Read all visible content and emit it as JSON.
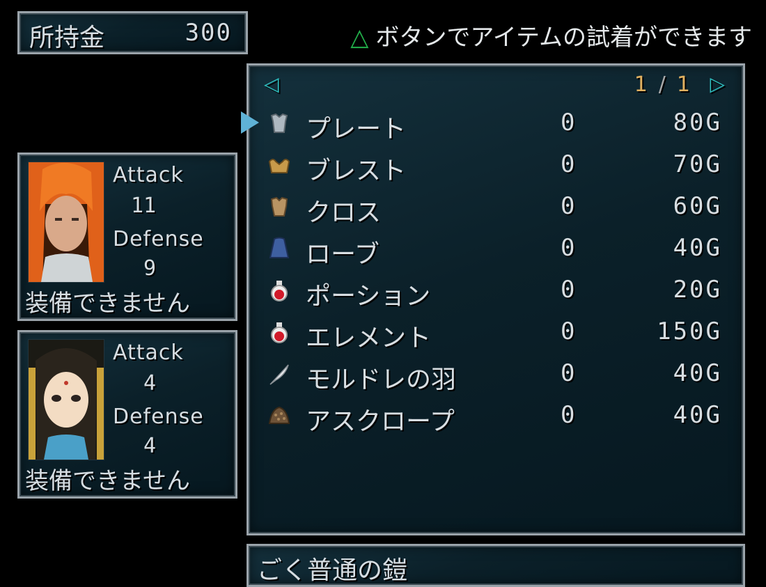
{
  "money": {
    "label": "所持金",
    "value": "300"
  },
  "hint": {
    "symbol": "△",
    "text": "ボタンでアイテムの試着ができます",
    "symbol_color": "#22b04a"
  },
  "pager": {
    "current": "1",
    "separator": "/",
    "total": "1",
    "left_arrow": "◁",
    "right_arrow": "▷"
  },
  "columns": {},
  "items": [
    {
      "name": "プレート",
      "qty": "0",
      "price": "80G",
      "icon": "plate-armor-icon"
    },
    {
      "name": "ブレスト",
      "qty": "0",
      "price": "70G",
      "icon": "breastplate-icon"
    },
    {
      "name": "クロス",
      "qty": "0",
      "price": "60G",
      "icon": "cloth-armor-icon"
    },
    {
      "name": "ローブ",
      "qty": "0",
      "price": "40G",
      "icon": "robe-icon"
    },
    {
      "name": "ポーション",
      "qty": "0",
      "price": "20G",
      "icon": "potion-icon"
    },
    {
      "name": "エレメント",
      "qty": "0",
      "price": "150G",
      "icon": "element-potion-icon"
    },
    {
      "name": "モルドレの羽",
      "qty": "0",
      "price": "40G",
      "icon": "feather-icon"
    },
    {
      "name": "アスクロープ",
      "qty": "0",
      "price": "40G",
      "icon": "ascrope-icon"
    }
  ],
  "characters": [
    {
      "attack_label": "Attack",
      "attack": "11",
      "defense_label": "Defense",
      "defense": "9",
      "status": "装備できません",
      "portrait": "orange-haired-hero-portrait"
    },
    {
      "attack_label": "Attack",
      "attack": "4",
      "defense_label": "Defense",
      "defense": "4",
      "status": "装備できません",
      "portrait": "dark-haired-girl-portrait"
    }
  ],
  "description": "ごく普通の鎧",
  "colors": {
    "panel_bg": "#0b2029",
    "border": "#9aa3aa",
    "pager_number": "#e0b060",
    "arrow": "#2fbfc0"
  }
}
